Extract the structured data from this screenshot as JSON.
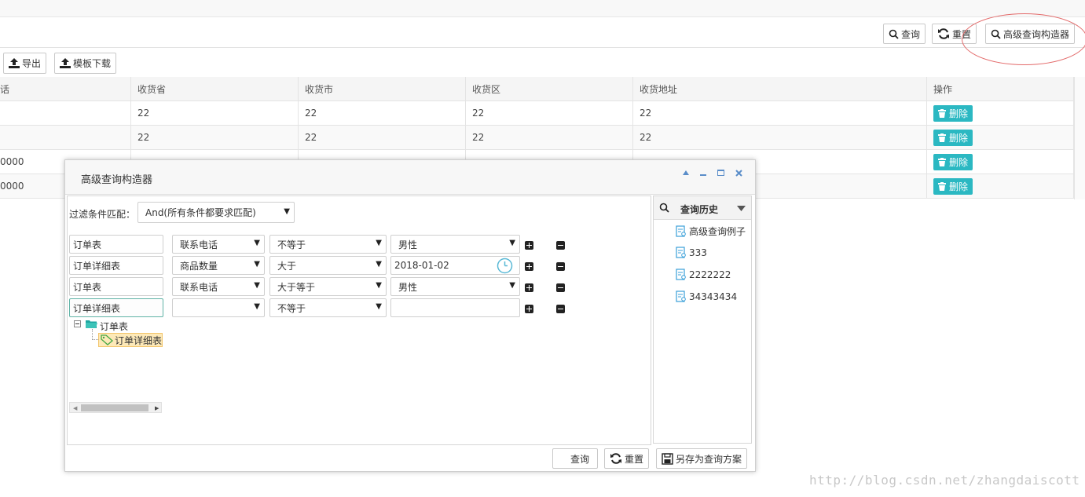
{
  "toolbar_top": {
    "query_label": "查询",
    "reset_label": "重置",
    "advanced_label": "高级查询构造器"
  },
  "toolbar_left": {
    "export_label": "导出",
    "template_label": "模板下载"
  },
  "grid": {
    "headers": [
      "话",
      "收货省",
      "收货市",
      "收货区",
      "收货地址",
      "操作"
    ],
    "rows": [
      {
        "c0": "",
        "province": "22",
        "city": "22",
        "district": "22",
        "address": "22"
      },
      {
        "c0": "",
        "province": "22",
        "city": "22",
        "district": "22",
        "address": "22"
      },
      {
        "c0": "0000",
        "province": "",
        "city": "",
        "district": "",
        "address": ""
      },
      {
        "c0": "0000",
        "province": "",
        "city": "",
        "district": "",
        "address": ""
      }
    ],
    "delete_label": "删除"
  },
  "dialog": {
    "title": "高级查询构造器",
    "match_label": "过滤条件匹配：",
    "match_value": "And(所有条件都要求匹配)",
    "conditions": [
      {
        "table": "订单表",
        "field": "联系电话",
        "op": "不等于",
        "value": "男性"
      },
      {
        "table": "订单详细表",
        "field": "商品数量",
        "op": "大于",
        "value": "2018-01-02"
      },
      {
        "table": "订单表",
        "field": "联系电话",
        "op": "大于等于",
        "value": "男性"
      },
      {
        "table": "订单详细表",
        "field": "",
        "op": "不等于",
        "value": ""
      }
    ],
    "tree": {
      "root": "订单表",
      "child": "订单详细表"
    },
    "history": {
      "title": "查询历史",
      "items": [
        "高级查询例子",
        "333",
        "2222222",
        "34343434"
      ]
    },
    "footer": {
      "query_label": "查询",
      "reset_label": "重置",
      "save_label": "另存为查询方案"
    }
  },
  "watermark": "http://blog.csdn.net/zhangdaiscott",
  "colors": {
    "accent": "#2bb8c2",
    "highlight_circle": "#e36a6a"
  }
}
